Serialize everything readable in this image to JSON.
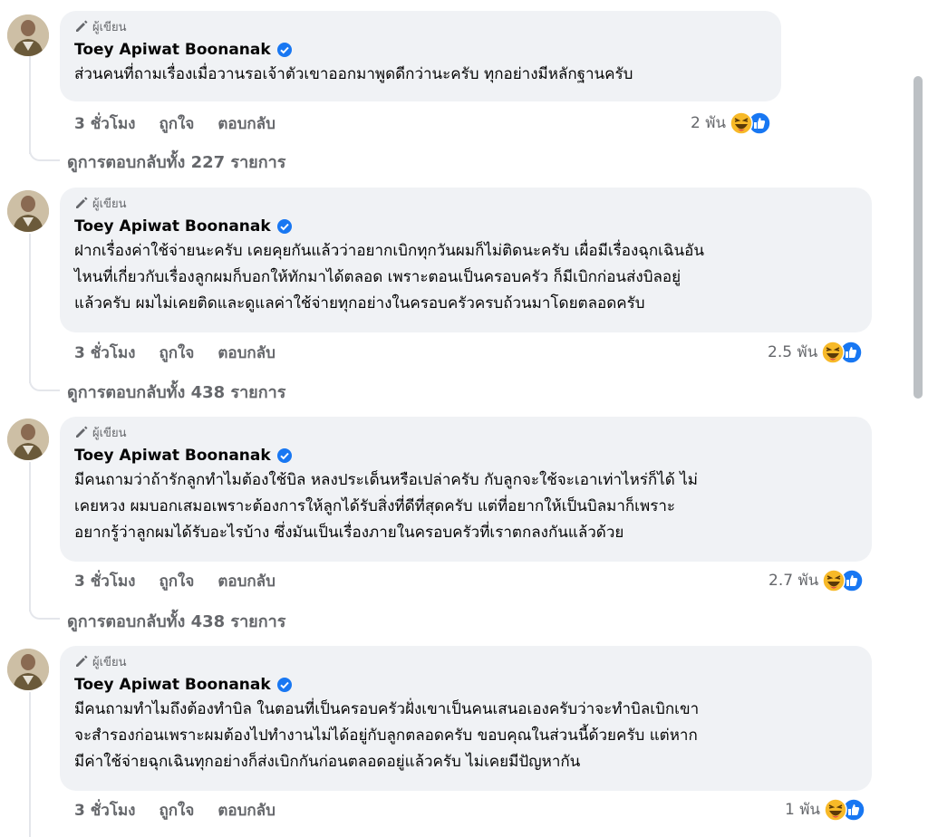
{
  "author_badge": "ผู้เขียน",
  "comments": [
    {
      "author": "Toey Apiwat Boonanak",
      "lines": [
        "ส่วนคนที่ถามเรื่องเมื่อวานรอเจ้าตัวเขาออกมาพูดดีกว่านะครับ ทุกอย่างมีหลักฐานครับ"
      ],
      "time": "3 ชั่วโมง",
      "like": "ถูกใจ",
      "reply": "ตอบกลับ",
      "reaction_count": "2 พัน",
      "view_replies": "ดูการตอบกลับทั้ง 227 รายการ"
    },
    {
      "author": "Toey Apiwat Boonanak",
      "lines": [
        "ฝากเรื่องค่าใช้จ่ายนะครับ เคยคุยกันแล้วว่าอยากเบิกทุกวันผมก็ไม่ติดนะครับ เผื่อมีเรื่องฉุกเฉินอัน",
        "ไหนที่เกี่ยวกับเรื่องลูกผมก็บอกให้ทักมาได้ตลอด เพราะตอนเป็นครอบครัว ก็มีเบิกก่อนส่งบิลอยู่",
        "แล้วครับ ผมไม่เคยติดและดูแลค่าใช้จ่ายทุกอย่างในครอบครัวครบถ้วนมาโดยตลอดครับ"
      ],
      "time": "3 ชั่วโมง",
      "like": "ถูกใจ",
      "reply": "ตอบกลับ",
      "reaction_count": "2.5 พัน",
      "view_replies": "ดูการตอบกลับทั้ง 438 รายการ"
    },
    {
      "author": "Toey Apiwat Boonanak",
      "lines": [
        "มีคนถามว่าถ้ารักลูกทำไมต้องใช้บิล หลงประเด็นหรือเปล่าครับ กับลูกจะใช้จะเอาเท่าไหร่ก็ได้ ไม่",
        "เคยหวง ผมบอกเสมอเพราะต้องการให้ลูกได้รับสิ่งที่ดีที่สุดครับ แต่ที่อยากให้เป็นบิลมาก็เพราะ",
        "อยากรู้ว่าลูกผมได้รับอะไรบ้าง ซึ่งมันเป็นเรื่องภายในครอบครัวที่เราตกลงกันแล้วด้วย"
      ],
      "time": "3 ชั่วโมง",
      "like": "ถูกใจ",
      "reply": "ตอบกลับ",
      "reaction_count": "2.7 พัน",
      "view_replies": "ดูการตอบกลับทั้ง 438 รายการ"
    },
    {
      "author": "Toey Apiwat Boonanak",
      "lines": [
        "มีคนถามทำไมถึงต้องทำบิล ในตอนที่เป็นครอบครัวฝั่งเขาเป็นคนเสนอเองครับว่าจะทำบิลเบิกเขา",
        "จะสำรองก่อนเพราะผมต้องไปทำงานไม่ได้อยู่กับลูกตลอดครับ ขอบคุณในส่วนนี้ด้วยครับ แต่หาก",
        "มีค่าใช้จ่ายฉุกเฉินทุกอย่างก็ส่งเบิกกันก่อนตลอดอยู่แล้วครับ ไม่เคยมีปัญหากัน"
      ],
      "time": "3 ชั่วโมง",
      "like": "ถูกใจ",
      "reply": "ตอบกลับ",
      "reaction_count": "1 พัน"
    }
  ],
  "colors": {
    "bubble_bg": "#f0f2f5",
    "secondary_text": "#65676b",
    "verified_blue": "#1877f2",
    "like_blue": "#1877f2",
    "haha_yellow": "#f7b928"
  },
  "icons": [
    "pencil-icon",
    "verified-badge-icon",
    "haha-reaction-icon",
    "like-reaction-icon"
  ]
}
